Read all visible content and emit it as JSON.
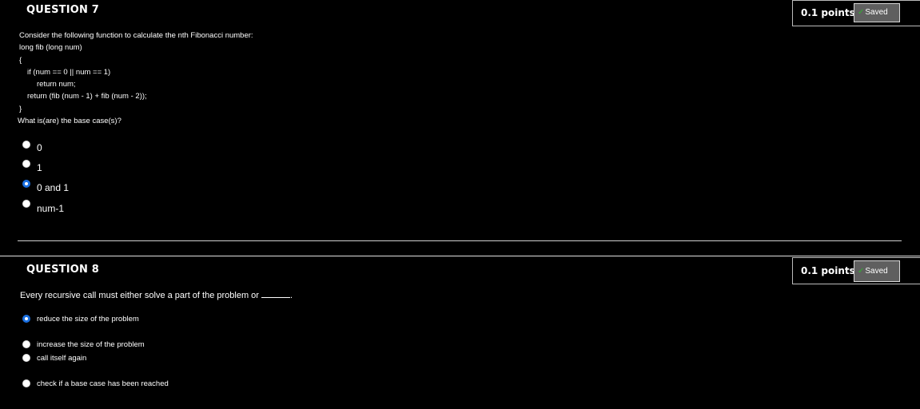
{
  "q7": {
    "title": "QUESTION 7",
    "points": "0.1 points",
    "saved": "Saved",
    "lines": [
      "Consider the following function to calculate the nth Fibonacci number:",
      "long fib (long num)",
      "{",
      "if (num == 0 || num == 1)",
      "return num;",
      "return (fib (num - 1) + fib (num - 2));",
      "}",
      "What is(are) the base case(s)?"
    ],
    "options": [
      "0",
      "1",
      "0 and 1",
      "num-1"
    ],
    "selected_index": 2
  },
  "q8": {
    "title": "QUESTION 8",
    "points": "0.1 points",
    "saved": "Saved",
    "prompt": "Every recursive call must either solve a part of the problem or",
    "prompt_end": ".",
    "options": [
      "reduce the size of the problem",
      "increase the size of the problem",
      "call itself again",
      "check if a base case has been reached"
    ],
    "selected_index": 0
  }
}
